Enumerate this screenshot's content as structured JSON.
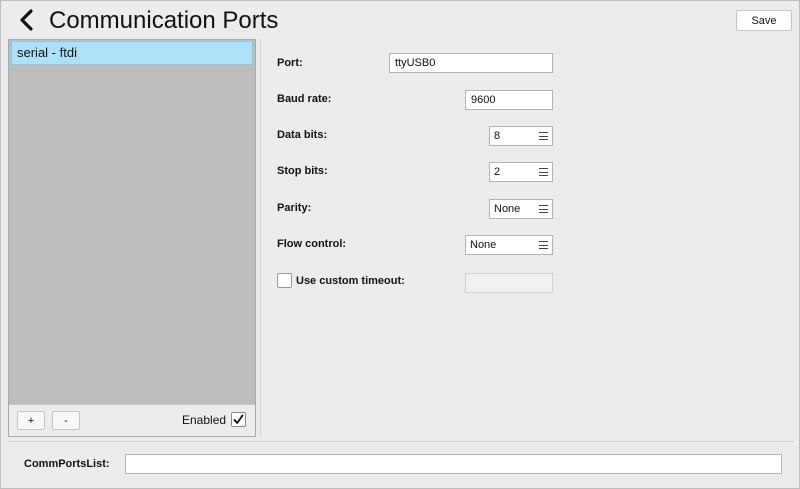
{
  "header": {
    "title": "Communication Ports",
    "save_label": "Save"
  },
  "sidebar": {
    "items": [
      {
        "label": "serial - ftdi",
        "selected": true
      }
    ],
    "add_label": "+",
    "remove_label": "-",
    "enabled_label": "Enabled",
    "enabled_checked": true
  },
  "form": {
    "port_label": "Port:",
    "port_value": "ttyUSB0",
    "baud_label": "Baud rate:",
    "baud_value": "9600",
    "databits_label": "Data bits:",
    "databits_value": "8",
    "stopbits_label": "Stop bits:",
    "stopbits_value": "2",
    "parity_label": "Parity:",
    "parity_value": "None",
    "flow_label": "Flow control:",
    "flow_value": "None",
    "timeout_label": "Use custom timeout:",
    "timeout_checked": false,
    "timeout_value": ""
  },
  "footer": {
    "commports_label": "CommPortsList:",
    "commports_value": ""
  },
  "icons": {
    "back": "chevron-left-icon",
    "select": "menu-lines-icon",
    "check": "checkmark-icon"
  },
  "colors": {
    "selection": "#aee0f7",
    "list_background": "#bdbdbd",
    "window_background": "#ececec"
  }
}
